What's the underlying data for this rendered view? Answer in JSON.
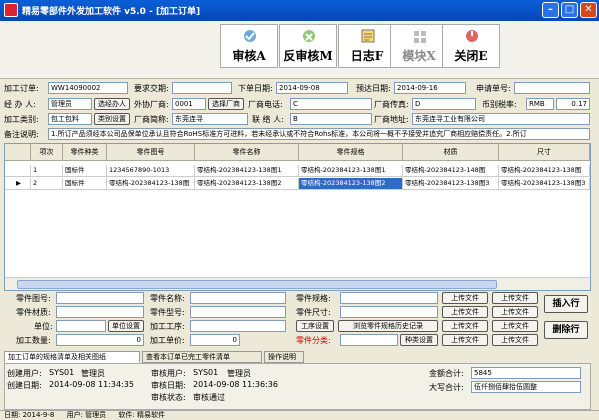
{
  "window": {
    "title": "精易零部件外发加工软件 v5.0 - [加工订单]",
    "min": "–",
    "max": "□",
    "close": "✕"
  },
  "toolbar": {
    "approve": "审核A",
    "unapprove": "反审核M",
    "log": "日志F",
    "module": "模块X",
    "close": "关闭E"
  },
  "form": {
    "order_no_label": "加工订单:",
    "order_no": "WW14090002",
    "req_delivery_label": "要求交期:",
    "req_delivery": "",
    "order_date_label": "下单日期:",
    "order_date": "2014-09-08",
    "est_date_label": "预达日期:",
    "est_date": "2014-09-16",
    "apply_no_label": "申请单号:",
    "apply_no": "",
    "handler_label": "经 办 人:",
    "handler": "管理员",
    "handler_btn": "选经办人",
    "vendor_no_label": "外协厂商:",
    "vendor_no": "0001",
    "vendor_btn": "选择厂商",
    "vendor_phone_label": "厂商电话:",
    "vendor_phone": "C",
    "vendor_fax_label": "厂商传真:",
    "vendor_fax": "D",
    "currency_label": "币别税率:",
    "currency": "RMB",
    "tax": "0.17",
    "type_label": "加工类别:",
    "type": "包工包料",
    "type_btn": "类别设置",
    "vendor_short_label": "厂商简称:",
    "vendor_short": "东莞连寻",
    "contact_label": "联 络 人:",
    "contact": "B",
    "vendor_addr_label": "厂商地址:",
    "vendor_addr": "东莞连寻工业有限公司",
    "remark_label": "备注说明:",
    "remark": "1.所订产品须经本公司品保单位承认且符合RoHS标准方可进料，若未经承认或不符合Rohs标准，本公司将一概不予接受并追究厂商相应赔偿责任。2.所订"
  },
  "grid": {
    "headers": [
      "项次",
      "零件种类",
      "零件图号",
      "零件名称",
      "零件规格",
      "材质",
      "尺寸"
    ],
    "rows": [
      [
        "1",
        "国标件",
        "1234567890-1013",
        "零结构-202384123-138图1",
        "零结构-202384123-138图1",
        "零结构-202384123-148图",
        "零结构-202384123-138图"
      ],
      [
        "2",
        "国标件",
        "零结构-202384123-138图",
        "零结构-202384123-138图2",
        "零结构-202384123-138图2",
        "零结构-202384123-138图3",
        "零结构-202384123-138图3"
      ]
    ],
    "current_marker": "▶"
  },
  "detail": {
    "part_no_label": "零件图号:",
    "part_name_label": "零件名称:",
    "part_spec_label": "零件规格:",
    "material_label": "零件材质:",
    "model_label": "零件型号:",
    "size_label": "零件尺寸:",
    "unit_label": "单位:",
    "unit_btn": "单位设置",
    "process_label": "加工工序:",
    "process_btn": "工序设置",
    "history_btn": "浏览零件规格历史记录",
    "qty_label": "加工数量:",
    "qty": "0",
    "price_label": "加工单价:",
    "price": "0",
    "category_label": "零件分类:",
    "category_btn": "种类设置",
    "upload": "上传文件",
    "insert": "插入行",
    "delete": "删除行"
  },
  "tabs": [
    "加工订单的规格清单及相关图纸",
    "查看本订单已完工零件清单",
    "操作说明"
  ],
  "footer": {
    "creator_label": "创建用户:",
    "creator_id": "SYS01",
    "creator_name": "管理员",
    "create_date_label": "创建日期:",
    "create_date": "2014-09-08 11:34:35",
    "approver_label": "审核用户:",
    "approver_id": "SYS01",
    "approver_name": "管理员",
    "approve_date_label": "审核日期:",
    "approve_date": "2014-09-08 11:36:36",
    "approve_status_label": "审核状态:",
    "approve_status": "审核通过",
    "total_label": "金额合计:",
    "total": "5845",
    "total_cn_label": "大写合计:",
    "total_cn": "伍仟捌佰肆拾伍圆整"
  },
  "status": {
    "date": "日期: 2014-9-8",
    "user": "用户: 管理员",
    "software": "软件: 精易软件"
  }
}
